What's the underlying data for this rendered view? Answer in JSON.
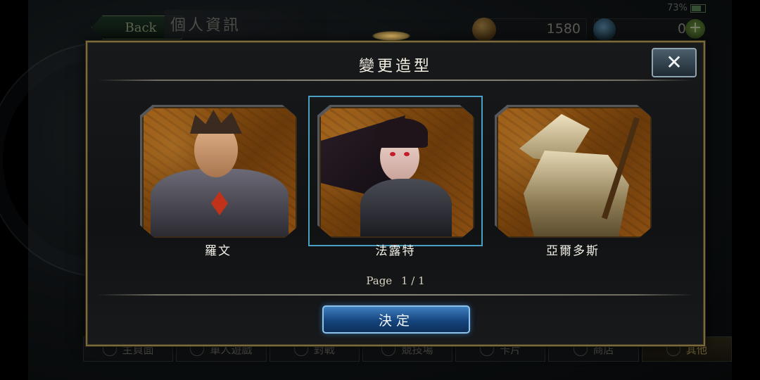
{
  "status_bar": {
    "battery": "73%"
  },
  "header": {
    "back_label": "Back",
    "page_title": "個人資訊"
  },
  "currency": {
    "gold": "1580",
    "gems": "0"
  },
  "bottom_nav": [
    {
      "label": "主頁面"
    },
    {
      "label": "單人遊戲"
    },
    {
      "label": "對戰"
    },
    {
      "label": "競技場"
    },
    {
      "label": "卡片"
    },
    {
      "label": "商店"
    },
    {
      "label": "其他"
    }
  ],
  "dialog": {
    "title": "變更造型",
    "characters": [
      {
        "name": "羅文",
        "selected": false
      },
      {
        "name": "法露特",
        "selected": true
      },
      {
        "name": "亞爾多斯",
        "selected": false
      }
    ],
    "page_label": "Page",
    "page_value": "1 / 1",
    "confirm_label": "決定",
    "colors": {
      "frame_gold": "#7b6a3b",
      "selection_blue": "#4aa0c4",
      "confirm_blue": "#15457e"
    }
  }
}
